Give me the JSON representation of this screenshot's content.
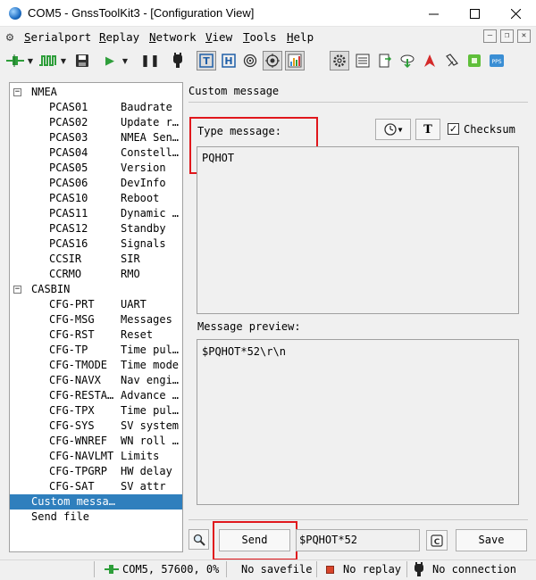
{
  "window": {
    "title": "COM5 - GnssToolKit3 - [Configuration View]",
    "minimize_icon": "minimize-icon",
    "maximize_icon": "maximize-icon",
    "close_icon": "close-icon"
  },
  "menu": {
    "items": [
      {
        "label": "Serialport",
        "mnemonic": "S"
      },
      {
        "label": "Replay",
        "mnemonic": "R"
      },
      {
        "label": "Network",
        "mnemonic": "N"
      },
      {
        "label": "View",
        "mnemonic": "V"
      },
      {
        "label": "Tools",
        "mnemonic": "T"
      },
      {
        "label": "Help",
        "mnemonic": "H"
      }
    ],
    "mdi_buttons": [
      "minimize-icon",
      "restore-icon",
      "close-icon"
    ]
  },
  "toolbar": {
    "icons": [
      "connect-icon",
      "dropdown-icon",
      "signal-icon",
      "dropdown-icon",
      "save-icon",
      "play-icon",
      "dropdown-icon",
      "pause-icon",
      "device-icon",
      "text-view-icon",
      "hex-view-icon",
      "target-icon",
      "position-icon",
      "chart-icon",
      "settings-icon",
      "list-icon",
      "export-icon",
      "download-icon",
      "navigation-icon",
      "satellite-icon",
      "app-icon",
      "pps-icon"
    ],
    "pps_label": "PPS"
  },
  "tree": {
    "groups": [
      {
        "label": "NMEA",
        "expand_symbol": "−",
        "items": [
          {
            "code": "PCAS01",
            "desc": "Baudrate"
          },
          {
            "code": "PCAS02",
            "desc": "Update r…"
          },
          {
            "code": "PCAS03",
            "desc": "NMEA Sen…"
          },
          {
            "code": "PCAS04",
            "desc": "Constell…"
          },
          {
            "code": "PCAS05",
            "desc": "Version"
          },
          {
            "code": "PCAS06",
            "desc": "DevInfo"
          },
          {
            "code": "PCAS10",
            "desc": "Reboot"
          },
          {
            "code": "PCAS11",
            "desc": "Dynamic …"
          },
          {
            "code": "PCAS12",
            "desc": "Standby"
          },
          {
            "code": "PCAS16",
            "desc": "Signals"
          },
          {
            "code": "CCSIR",
            "desc": "SIR"
          },
          {
            "code": "CCRMO",
            "desc": "RMO"
          }
        ]
      },
      {
        "label": "CASBIN",
        "expand_symbol": "−",
        "items": [
          {
            "code": "CFG-PRT",
            "desc": "UART"
          },
          {
            "code": "CFG-MSG",
            "desc": "Messages"
          },
          {
            "code": "CFG-RST",
            "desc": "Reset"
          },
          {
            "code": "CFG-TP",
            "desc": "Time pul…"
          },
          {
            "code": "CFG-TMODE",
            "desc": "Time mode"
          },
          {
            "code": "CFG-NAVX",
            "desc": "Nav engi…"
          },
          {
            "code": "CFG-RESTA…",
            "desc": "Advance …"
          },
          {
            "code": "CFG-TPX",
            "desc": "Time pul…"
          },
          {
            "code": "CFG-SYS",
            "desc": "SV system"
          },
          {
            "code": "CFG-WNREF",
            "desc": "WN roll …"
          },
          {
            "code": "CFG-NAVLMT",
            "desc": "Limits"
          },
          {
            "code": "CFG-TPGRP",
            "desc": "HW delay"
          },
          {
            "code": "CFG-SAT",
            "desc": "SV attr"
          }
        ]
      }
    ],
    "extra": [
      {
        "label": "Custom messa…",
        "selected": true
      },
      {
        "label": "Send file",
        "selected": false
      }
    ]
  },
  "panel": {
    "title": "Custom message",
    "type_label": "Type message:",
    "clock_icon": "clock-icon",
    "text_icon": "text-format-icon",
    "checksum_checked": true,
    "checksum_mark": "✓",
    "checksum_label": "Checksum",
    "message_text": "PQHOT",
    "preview_label": "Message preview:",
    "preview_text": "$PQHOT*52\\r\\n",
    "send_label": "Send",
    "command_value": "$PQHOT*52",
    "save_label": "Save",
    "highlight_color": "#e0171c"
  },
  "status": {
    "port": "COM5, 57600, 0%",
    "savefile": "No savefile",
    "replay": "No replay",
    "connection": "No connection"
  },
  "colors": {
    "selection": "#2f7fbd",
    "accent_green": "#2e9e3a"
  }
}
